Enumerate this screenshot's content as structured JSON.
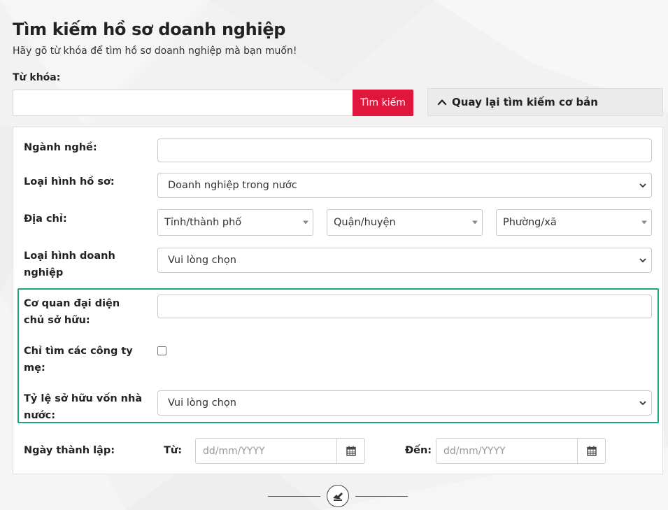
{
  "header": {
    "title": "Tìm kiếm hồ sơ doanh nghiệp",
    "subtitle": "Hãy gõ từ khóa để tìm hồ sơ doanh nghiệp mà bạn muốn!"
  },
  "search": {
    "keyword_label": "Từ khóa:",
    "keyword_value": "",
    "search_button": "Tìm kiếm",
    "back_button": "Quay lại tìm kiếm cơ bản"
  },
  "form": {
    "industry": {
      "label": "Ngành nghề:",
      "value": ""
    },
    "profile_type": {
      "label": "Loại hình hồ sơ:",
      "value": "Doanh nghiệp trong nước"
    },
    "address": {
      "label": "Địa chỉ:",
      "province": "Tỉnh/thành phố",
      "district": "Quận/huyện",
      "ward": "Phường/xã"
    },
    "business_type": {
      "label_line1": "Loại hình doanh",
      "label_line2": "nghiệp",
      "value": "Vui lòng chọn"
    },
    "owner_agency": {
      "label_line1": "Cơ quan đại diện",
      "label_line2": "chủ sở hữu:",
      "value": ""
    },
    "parent_only": {
      "label_line1": "Chỉ tìm các công ty",
      "label_line2": "mẹ:",
      "checked": false
    },
    "state_capital_ratio": {
      "label_line1": "Tỷ lệ sở hữu vốn nhà",
      "label_line2": "nước:",
      "value": "Vui lòng chọn"
    },
    "founded_date": {
      "label": "Ngày thành lập:",
      "from_label": "Từ:",
      "to_label": "Đến:",
      "from_placeholder": "dd/mm/YYYY",
      "to_placeholder": "dd/mm/YYYY"
    }
  },
  "colors": {
    "accent_red": "#e0163c",
    "highlight_green": "#1fa07f"
  },
  "icons": {
    "back": "chevron-up-icon",
    "calendar": "calendar-icon",
    "select": "chevron-down-icon",
    "footer": "logo-icon"
  }
}
